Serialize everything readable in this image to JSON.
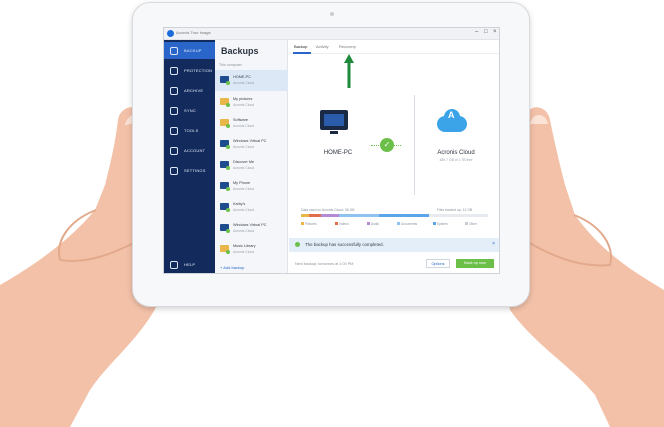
{
  "app": {
    "window_title": "Acronis True Image"
  },
  "sidebar": {
    "items": [
      {
        "label": "BACKUP",
        "icon": "backup-icon",
        "active": true
      },
      {
        "label": "PROTECTION",
        "icon": "shield-icon"
      },
      {
        "label": "ARCHIVE",
        "icon": "archive-icon"
      },
      {
        "label": "SYNC",
        "icon": "sync-icon"
      },
      {
        "label": "TOOLS",
        "icon": "tools-icon"
      },
      {
        "label": "ACCOUNT",
        "icon": "account-icon"
      },
      {
        "label": "SETTINGS",
        "icon": "settings-icon"
      }
    ],
    "help": "HELP"
  },
  "list": {
    "title": "Backups",
    "group": "This computer",
    "items": [
      {
        "name": "HOME-PC",
        "sub": "Acronis Cloud",
        "kind": "pc",
        "selected": true
      },
      {
        "name": "My pictures",
        "sub": "Acronis Cloud",
        "kind": "folder"
      },
      {
        "name": "Software",
        "sub": "Acronis Cloud",
        "kind": "folder"
      },
      {
        "name": "Windows Virtual PC",
        "sub": "Acronis Cloud",
        "kind": "pc"
      },
      {
        "name": "Discover Me",
        "sub": "Acronis Cloud",
        "kind": "pc"
      },
      {
        "name": "My Phone",
        "sub": "Acronis Cloud",
        "kind": "pc"
      },
      {
        "name": "Kathy's",
        "sub": "Acronis Cloud",
        "kind": "pc"
      },
      {
        "name": "Windows Virtual PC",
        "sub": "Acronis Cloud",
        "kind": "pc"
      },
      {
        "name": "Music Library",
        "sub": "Acronis Cloud",
        "kind": "folder"
      }
    ],
    "add_label": "Add backup"
  },
  "main": {
    "tabs": [
      "Backup",
      "Activity",
      "Recovery"
    ],
    "source_label": "HOME-PC",
    "destination_label": "Acronis Cloud",
    "destination_sub": "489.7 GB of 1 TB free",
    "usage_left": "Data used on Acronis Cloud: 36 GB",
    "usage_right": "Files backed up: 12 GB",
    "legend": [
      "Pictures",
      "Videos",
      "Audio",
      "Documents",
      "System",
      "Other"
    ],
    "toast": "The backup has successfully completed.",
    "footer_text": "Next backup: tomorrow at 1:00 PM",
    "options_label": "Options",
    "backup_now_label": "Back up now"
  },
  "colors": {
    "sidebar": "#122a5c",
    "accent": "#2a66c9",
    "success": "#6cc04a",
    "cloud": "#3ba3e8"
  }
}
